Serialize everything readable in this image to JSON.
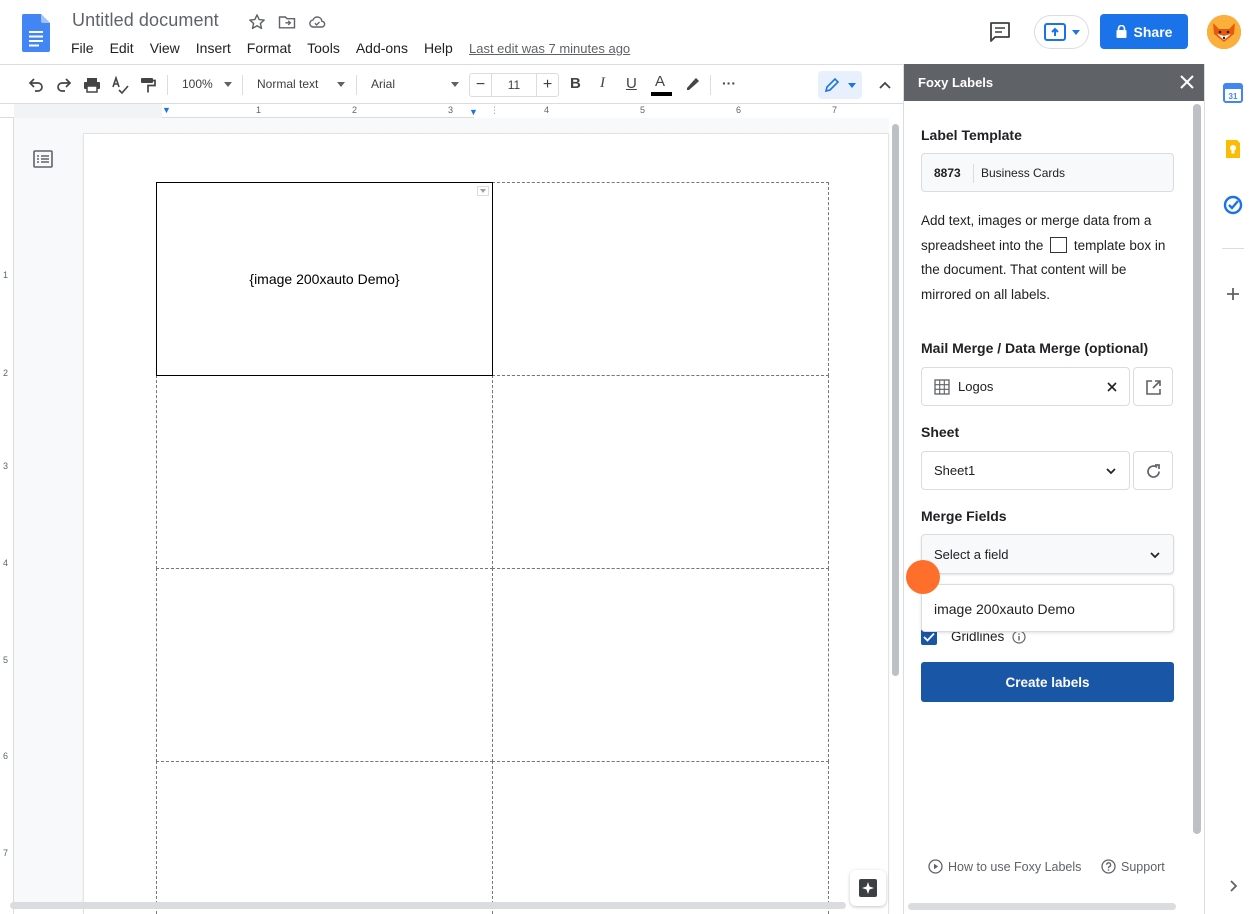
{
  "header": {
    "title": "Untitled document",
    "menu": [
      "File",
      "Edit",
      "View",
      "Insert",
      "Format",
      "Tools",
      "Add-ons",
      "Help"
    ],
    "last_edit": "Last edit was 7 minutes ago",
    "share_label": "Share"
  },
  "toolbar": {
    "zoom": "100%",
    "style": "Normal text",
    "font": "Arial",
    "font_size": "11",
    "bold_label": "B",
    "italic_label": "I",
    "underline_label": "U",
    "text_color_label": "A",
    "more_label": "···"
  },
  "ruler": {
    "h_marks": [
      "1",
      "1",
      "2",
      "3",
      "4",
      "5",
      "6",
      "7"
    ],
    "v_marks": [
      "1",
      "2",
      "3",
      "4",
      "5",
      "6",
      "7"
    ]
  },
  "document": {
    "template_text": "{image 200xauto Demo}"
  },
  "panel": {
    "title": "Foxy Labels",
    "label_template_heading": "Label Template",
    "template_code": "8873",
    "template_name": "Business Cards",
    "instructions_part1": "Add text, images or merge data from a spreadsheet into the",
    "instructions_part2": "template box in the document. That content will be mirrored on all labels.",
    "mail_merge_heading": "Mail Merge / Data Merge (optional)",
    "merge_source": "Logos",
    "sheet_heading": "Sheet",
    "sheet_value": "Sheet1",
    "merge_fields_heading": "Merge Fields",
    "field_select_placeholder": "Select a field",
    "field_option": "image 200xauto Demo",
    "gridlines_label": "Gridlines",
    "create_button": "Create labels",
    "howto_link": "How to use Foxy Labels",
    "support_link": "Support"
  },
  "colors": {
    "accent": "#1a73e8",
    "panel_button": "#1a56a6",
    "panel_header": "#5f6368",
    "cursor": "#ff6f2c"
  },
  "icons": {
    "calendar": "calendar-icon",
    "keep": "keep-icon",
    "tasks": "tasks-icon"
  }
}
